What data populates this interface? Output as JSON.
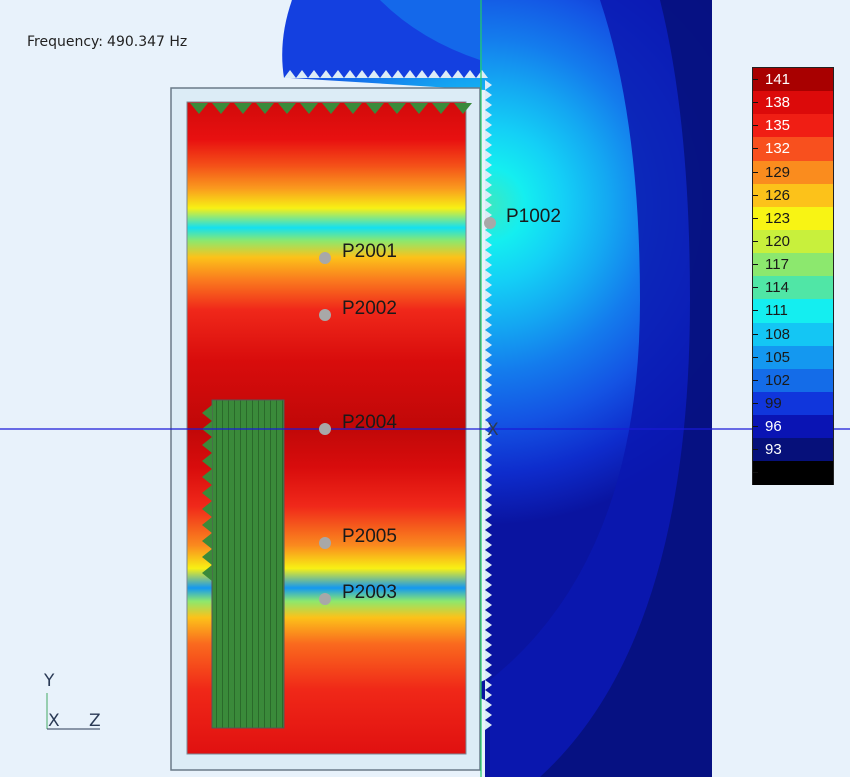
{
  "frequency": {
    "label": "Frequency:",
    "value": "490.347 Hz"
  },
  "probes": [
    {
      "id": "P1002"
    },
    {
      "id": "P2001"
    },
    {
      "id": "P2002"
    },
    {
      "id": "P2004"
    },
    {
      "id": "P2005"
    },
    {
      "id": "P2003"
    }
  ],
  "legend": {
    "levels": [
      {
        "value": "141",
        "color": "#a80000",
        "text_color": "#ffffff"
      },
      {
        "value": "138",
        "color": "#dc0a0a",
        "text_color": "#ffffff"
      },
      {
        "value": "135",
        "color": "#f01e14",
        "text_color": "#ffffff"
      },
      {
        "value": "132",
        "color": "#f8501e",
        "text_color": "#ffffff"
      },
      {
        "value": "129",
        "color": "#fa8c1e",
        "text_color": "#1a1a1a"
      },
      {
        "value": "126",
        "color": "#fcc21a",
        "text_color": "#1a1a1a"
      },
      {
        "value": "123",
        "color": "#f8f414",
        "text_color": "#1a1a1a"
      },
      {
        "value": "120",
        "color": "#c8f03c",
        "text_color": "#1a1a1a"
      },
      {
        "value": "117",
        "color": "#8ce86e",
        "text_color": "#1a1a1a"
      },
      {
        "value": "114",
        "color": "#50e6a6",
        "text_color": "#1a1a1a"
      },
      {
        "value": "111",
        "color": "#14eef0",
        "text_color": "#1a1a1a"
      },
      {
        "value": "108",
        "color": "#14c6f4",
        "text_color": "#1a1a1a"
      },
      {
        "value": "105",
        "color": "#1498f0",
        "text_color": "#1a1a1a"
      },
      {
        "value": "102",
        "color": "#146ce8",
        "text_color": "#1a1a1a"
      },
      {
        "value": "99",
        "color": "#1036dc",
        "text_color": "#1a1a1a"
      },
      {
        "value": "96",
        "color": "#0a14b4",
        "text_color": "#ffffff"
      },
      {
        "value": "93",
        "color": "#06107a",
        "text_color": "#ffffff"
      },
      {
        "value": "",
        "color": "#000000",
        "text_color": "#ffffff"
      }
    ]
  },
  "axes": {
    "y": "Y",
    "x": "X",
    "z": "Z",
    "section_marker": "X"
  },
  "colors": {
    "background": "#e8f2fb",
    "baffle": "#3a8a3a",
    "cut_line": "#1a1ad8",
    "probe_point": "#a8a8a8"
  }
}
